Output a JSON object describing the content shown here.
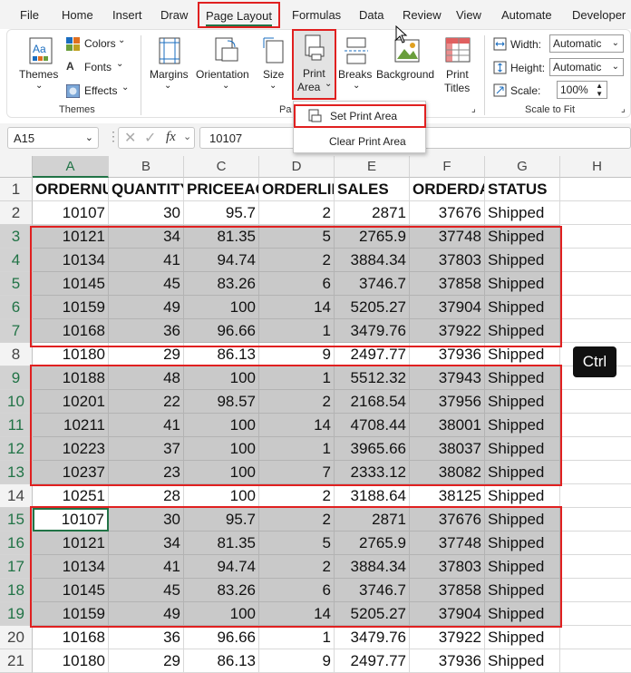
{
  "tabs": [
    "File",
    "Home",
    "Insert",
    "Draw",
    "Page Layout",
    "Formulas",
    "Data",
    "Review",
    "View",
    "Automate",
    "Developer"
  ],
  "ribbon": {
    "themes": "Themes",
    "colors": "Colors",
    "fonts": "Fonts",
    "effects": "Effects",
    "themes_group": "Themes",
    "margins": "Margins",
    "orientation": "Orientation",
    "size": "Size",
    "print": "Print",
    "area": "Area",
    "page_setup_group_partial": "Pa",
    "breaks": "Breaks",
    "background": "Background",
    "print_titles_1": "Print",
    "print_titles_2": "Titles",
    "width_label": "Width:",
    "width_value": "Automatic",
    "height_label": "Height:",
    "height_value": "Automatic",
    "scale_label": "Scale:",
    "scale_value": "100%",
    "scale_group": "Scale to Fit"
  },
  "dropdown": {
    "set_print_area": "Set Print Area",
    "clear_print_area": "Clear Print Area"
  },
  "formula_bar": {
    "name_box": "A15",
    "fx": "fx",
    "formula": "10107"
  },
  "columns": [
    "A",
    "B",
    "C",
    "D",
    "E",
    "F",
    "G",
    "H"
  ],
  "header_row": [
    "ORDERNUMBER",
    "QUANTITYORDERED",
    "PRICEEACH",
    "ORDERLINENUMBER",
    "SALES",
    "ORDERDATE",
    "STATUS"
  ],
  "rows": [
    [
      "10107",
      "30",
      "95.7",
      "2",
      "2871",
      "37676",
      "Shipped"
    ],
    [
      "10121",
      "34",
      "81.35",
      "5",
      "2765.9",
      "37748",
      "Shipped"
    ],
    [
      "10134",
      "41",
      "94.74",
      "2",
      "3884.34",
      "37803",
      "Shipped"
    ],
    [
      "10145",
      "45",
      "83.26",
      "6",
      "3746.7",
      "37858",
      "Shipped"
    ],
    [
      "10159",
      "49",
      "100",
      "14",
      "5205.27",
      "37904",
      "Shipped"
    ],
    [
      "10168",
      "36",
      "96.66",
      "1",
      "3479.76",
      "37922",
      "Shipped"
    ],
    [
      "10180",
      "29",
      "86.13",
      "9",
      "2497.77",
      "37936",
      "Shipped"
    ],
    [
      "10188",
      "48",
      "100",
      "1",
      "5512.32",
      "37943",
      "Shipped"
    ],
    [
      "10201",
      "22",
      "98.57",
      "2",
      "2168.54",
      "37956",
      "Shipped"
    ],
    [
      "10211",
      "41",
      "100",
      "14",
      "4708.44",
      "38001",
      "Shipped"
    ],
    [
      "10223",
      "37",
      "100",
      "1",
      "3965.66",
      "38037",
      "Shipped"
    ],
    [
      "10237",
      "23",
      "100",
      "7",
      "2333.12",
      "38082",
      "Shipped"
    ],
    [
      "10251",
      "28",
      "100",
      "2",
      "3188.64",
      "38125",
      "Shipped"
    ],
    [
      "10107",
      "30",
      "95.7",
      "2",
      "2871",
      "37676",
      "Shipped"
    ],
    [
      "10121",
      "34",
      "81.35",
      "5",
      "2765.9",
      "37748",
      "Shipped"
    ],
    [
      "10134",
      "41",
      "94.74",
      "2",
      "3884.34",
      "37803",
      "Shipped"
    ],
    [
      "10145",
      "45",
      "83.26",
      "6",
      "3746.7",
      "37858",
      "Shipped"
    ],
    [
      "10159",
      "49",
      "100",
      "14",
      "5205.27",
      "37904",
      "Shipped"
    ],
    [
      "10168",
      "36",
      "96.66",
      "1",
      "3479.76",
      "37922",
      "Shipped"
    ],
    [
      "10180",
      "29",
      "86.13",
      "9",
      "2497.77",
      "37936",
      "Shipped"
    ]
  ],
  "selected_rows": [
    3,
    4,
    5,
    6,
    7,
    9,
    10,
    11,
    12,
    13,
    15,
    16,
    17,
    18,
    19
  ],
  "ctrl_key": "Ctrl",
  "colors": {
    "highlight_red": "#e02020",
    "excel_green": "#217346",
    "selection_gray": "#c9c9c9"
  }
}
